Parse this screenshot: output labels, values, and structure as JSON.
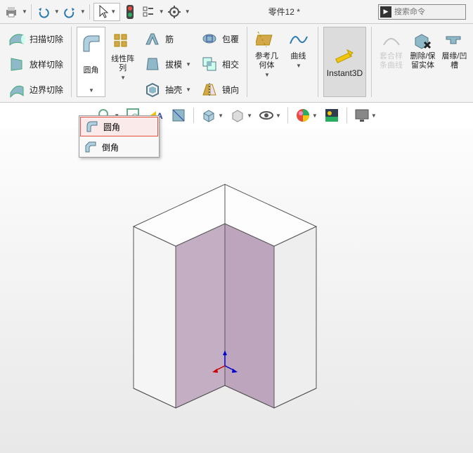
{
  "qat": {
    "title": "零件12 *",
    "search_placeholder": "搜索命令"
  },
  "ribbon": {
    "sweep_cut": "扫描切除",
    "loft_cut": "放样切除",
    "boundary_cut": "边界切除",
    "fillet": "圆角",
    "linear_pattern": "线性阵\n列",
    "rib": "筋",
    "draft": "拔模",
    "shell": "抽壳",
    "wrap": "包覆",
    "intersect": "相交",
    "mirror": "镜向",
    "ref_geom": "参考几\n何体",
    "curves": "曲线",
    "instant3d": "Instant3D",
    "fit_spline": "套合样\n条曲线",
    "delete_keep": "删除/保\n留实体",
    "lip_groove": "層缘/凹\n槽"
  },
  "dropdown": {
    "fillet": "圆角",
    "chamfer": "倒角"
  },
  "chart_data": null
}
